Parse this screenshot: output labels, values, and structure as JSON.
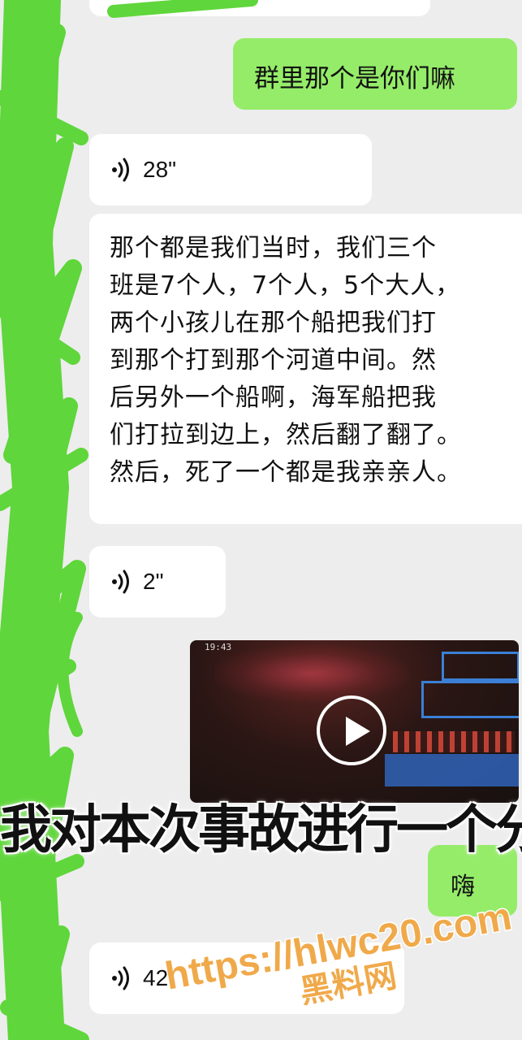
{
  "messages": {
    "sent_1": "群里那个是你们嘛",
    "voice_1": {
      "duration": "28\""
    },
    "transcript_lines": [
      "那个都是我们当时，我们三个",
      "班是7个人，7个人，5个大人，",
      "两个小孩儿在那个船把我们打",
      "到那个打到那个河道中间。然",
      "后另外一个船啊，海军船把我",
      "们打拉到边上，然后翻了翻了。",
      "然后，死了一个都是我亲亲人。"
    ],
    "voice_2": {
      "duration": "2\""
    },
    "video": {
      "timestamp": "19:43"
    },
    "reply": "嗨",
    "voice_3": {
      "duration": "42\""
    }
  },
  "overlay": {
    "caption": "我对本次事故进行一个分",
    "watermark_url": "https://hlwc20.com",
    "watermark_name": "黑料网"
  },
  "colors": {
    "sent_bubble": "#95ec69",
    "received_bubble": "#ffffff",
    "chat_background": "#ededed",
    "scribble": "#5fd63b",
    "watermark": "#f0a94a"
  },
  "icons": {
    "voice": "voice-wave-icon",
    "play": "play-icon"
  }
}
